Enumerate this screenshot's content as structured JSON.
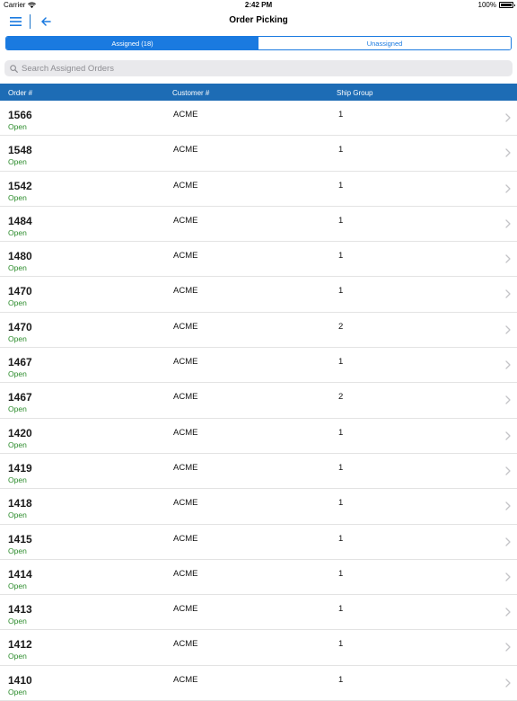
{
  "status_bar": {
    "carrier": "Carrier",
    "time": "2:42 PM",
    "battery": "100%",
    "battery_level": 1.0
  },
  "nav": {
    "title": "Order Picking"
  },
  "tabs": [
    {
      "label": "Assigned (18)",
      "selected": true
    },
    {
      "label": "Unassigned",
      "selected": false
    }
  ],
  "search": {
    "placeholder": "Search Assigned Orders",
    "value": ""
  },
  "table": {
    "columns": [
      "Order #",
      "Customer #",
      "Ship Group"
    ],
    "rows": [
      {
        "order": "1566",
        "status": "Open",
        "customer": "ACME",
        "ship_group": "1"
      },
      {
        "order": "1548",
        "status": "Open",
        "customer": "ACME",
        "ship_group": "1"
      },
      {
        "order": "1542",
        "status": "Open",
        "customer": "ACME",
        "ship_group": "1"
      },
      {
        "order": "1484",
        "status": "Open",
        "customer": "ACME",
        "ship_group": "1"
      },
      {
        "order": "1480",
        "status": "Open",
        "customer": "ACME",
        "ship_group": "1"
      },
      {
        "order": "1470",
        "status": "Open",
        "customer": "ACME",
        "ship_group": "1"
      },
      {
        "order": "1470",
        "status": "Open",
        "customer": "ACME",
        "ship_group": "2"
      },
      {
        "order": "1467",
        "status": "Open",
        "customer": "ACME",
        "ship_group": "1"
      },
      {
        "order": "1467",
        "status": "Open",
        "customer": "ACME",
        "ship_group": "2"
      },
      {
        "order": "1420",
        "status": "Open",
        "customer": "ACME",
        "ship_group": "1"
      },
      {
        "order": "1419",
        "status": "Open",
        "customer": "ACME",
        "ship_group": "1"
      },
      {
        "order": "1418",
        "status": "Open",
        "customer": "ACME",
        "ship_group": "1"
      },
      {
        "order": "1415",
        "status": "Open",
        "customer": "ACME",
        "ship_group": "1"
      },
      {
        "order": "1414",
        "status": "Open",
        "customer": "ACME",
        "ship_group": "1"
      },
      {
        "order": "1413",
        "status": "Open",
        "customer": "ACME",
        "ship_group": "1"
      },
      {
        "order": "1412",
        "status": "Open",
        "customer": "ACME",
        "ship_group": "1"
      },
      {
        "order": "1410",
        "status": "Open",
        "customer": "ACME",
        "ship_group": "1"
      }
    ]
  },
  "colors": {
    "accent": "#1a7ae0",
    "header_bg": "#1d6cb5",
    "status_open": "#2c8c2c"
  },
  "icons": {
    "menu": "hamburger-menu-icon",
    "back": "back-arrow-icon",
    "search": "search-icon",
    "row": "chevron-right-icon"
  }
}
